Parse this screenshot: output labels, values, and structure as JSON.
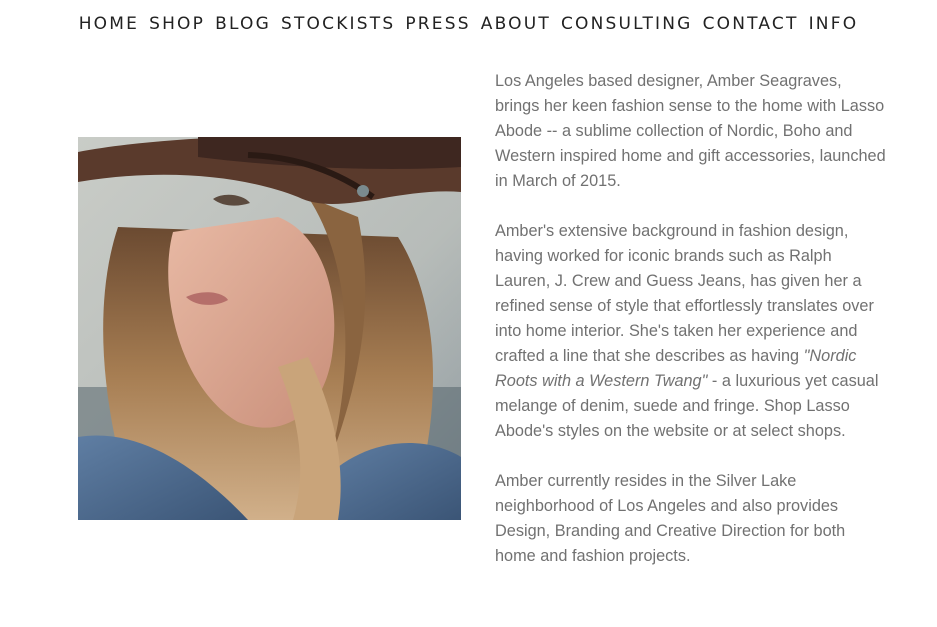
{
  "nav": {
    "items": [
      "HOME",
      "SHOP",
      "BLOG",
      "STOCKISTS",
      "PRESS",
      "ABOUT",
      "CONSULTING",
      "CONTACT",
      "INFO"
    ]
  },
  "photo": {
    "alt_icon": "portrait-photo"
  },
  "bio": {
    "p1": "Los Angeles based designer, Amber Seagraves, brings her keen fashion sense to the home with Lasso Abode -- a sublime collection of Nordic, Boho and Western inspired home and gift accessories, launched in March of 2015.",
    "p2_before": "Amber's extensive background in fashion design, having worked for iconic brands such as Ralph Lauren, J. Crew and Guess Jeans, has given her a refined sense of style that effortlessly translates over into home interior. She's taken her experience and crafted a line that she describes as having ",
    "p2_quote": "\"Nordic Roots with a Western Twang\"",
    "p2_after": " - a luxurious yet casual melange of denim, suede and fringe. Shop Lasso Abode's styles on the website or at select shops.",
    "p3": "Amber currently resides in the Silver Lake neighborhood of Los Angeles and also provides Design, Branding and Creative Direction for both home and fashion projects."
  }
}
